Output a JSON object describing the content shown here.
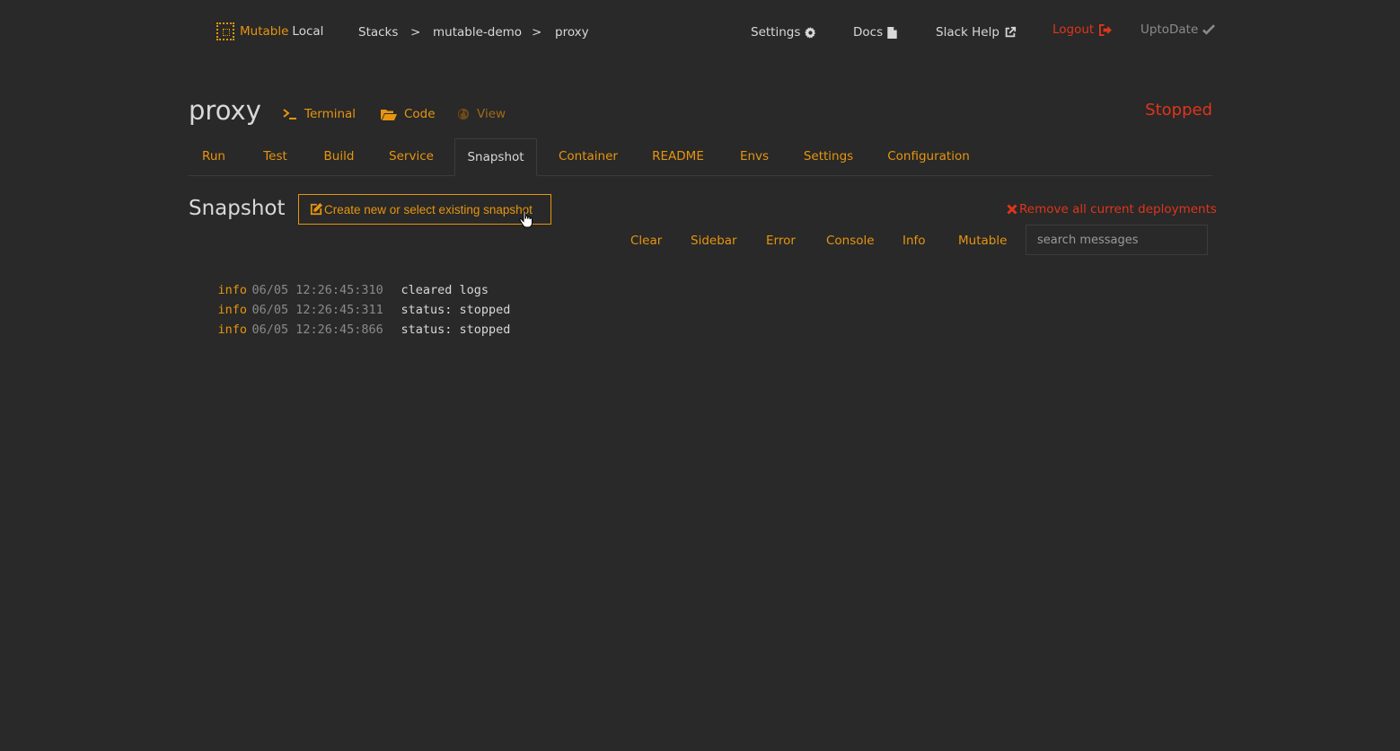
{
  "app": {
    "logo_word1": "Mutable",
    "logo_word2": "Local",
    "logo_icon": "mutable-logo-icon"
  },
  "breadcrumb": {
    "items": [
      "Stacks",
      "mutable-demo",
      "proxy"
    ],
    "separator": ">"
  },
  "topnav": {
    "settings": "Settings",
    "docs": "Docs",
    "slack_help": "Slack Help",
    "logout": "Logout",
    "uptodate": "UptoDate",
    "icons": {
      "settings": "gear-icon",
      "docs": "file-icon",
      "slack_help": "external-link-icon",
      "logout": "logout-icon",
      "uptodate": "check-icon"
    }
  },
  "header": {
    "title": "proxy",
    "terminal": "Terminal",
    "code": "Code",
    "view": "View",
    "status": "Stopped"
  },
  "tabs": [
    {
      "label": "Run",
      "active": false
    },
    {
      "label": "Test",
      "active": false
    },
    {
      "label": "Build",
      "active": false
    },
    {
      "label": "Service",
      "active": false
    },
    {
      "label": "Snapshot",
      "active": true
    },
    {
      "label": "Container",
      "active": false
    },
    {
      "label": "README",
      "active": false
    },
    {
      "label": "Envs",
      "active": false
    },
    {
      "label": "Settings",
      "active": false
    },
    {
      "label": "Configuration",
      "active": false
    }
  ],
  "snapshot": {
    "title": "Snapshot",
    "create_button": "Create new or select existing snapshot",
    "remove_link": "Remove all current deployments"
  },
  "filters": [
    "Clear",
    "Sidebar",
    "Error",
    "Console",
    "Info",
    "Mutable"
  ],
  "search": {
    "placeholder": "search messages",
    "value": ""
  },
  "logs": [
    {
      "level": "info",
      "timestamp": "06/05 12:26:45:310",
      "message": "cleared logs"
    },
    {
      "level": "info",
      "timestamp": "06/05 12:26:45:311",
      "message": "status: stopped"
    },
    {
      "level": "info",
      "timestamp": "06/05 12:26:45:866",
      "message": "status: stopped"
    }
  ],
  "colors": {
    "background": "#282928",
    "accent": "#e8940f",
    "danger": "#e0341c",
    "text": "#d8d8d8"
  }
}
